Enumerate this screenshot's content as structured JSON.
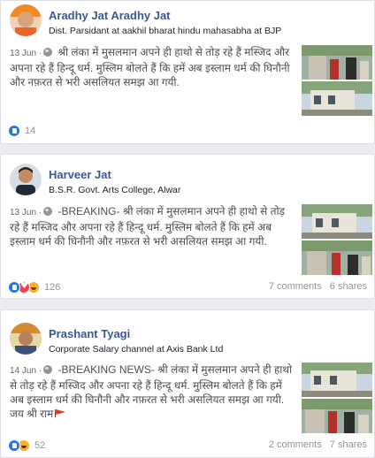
{
  "posts": [
    {
      "author": "Aradhy Jat Aradhy Jat",
      "subtitle": "Dist. Parsidant at aakhil bharat hindu mahasabha at BJP",
      "date": "13 Jun",
      "text": "श्री लंका में मुसलमान अपने ही हाथो से तोड़ रहे हैं मस्जिद और अपना रहे हैं हिन्दू धर्म. मुस्लिम बोलते हैं कि हमें अब इस्लाम धर्म की घिनौनी और नफ़रत से भरी असलियत समझ आ गयी.",
      "reactions": [
        "like"
      ],
      "reaction_count": "14",
      "comments": "",
      "shares": ""
    },
    {
      "author": "Harveer Jat",
      "subtitle": "B.S.R. Govt. Arts College, Alwar",
      "date": "13 Jun",
      "text": "-BREAKING- श्री लंका में मुसलमान अपने ही हाथो से तोड़ रहे हैं मस्जिद और अपना रहे हैं हिन्दू धर्म. मुस्लिम बोलते हैं कि हमें अब इस्लाम धर्म की घिनौनी और नफ़रत से भरी असलियत समझ आ गयी.",
      "reactions": [
        "like",
        "love",
        "haha"
      ],
      "reaction_count": "126",
      "comments": "7 comments",
      "shares": "6 shares"
    },
    {
      "author": "Prashant Tyagi",
      "subtitle": "Corporate Salary channel at Axis Bank Ltd",
      "date": "14 Jun",
      "text": "-BREAKING NEWS- श्री लंका में मुसलमान अपने ही हाथो से तोड़ रहे हैं मस्जिद और अपना रहे हैं हिन्दू धर्म. मुस्लिम बोलते हैं कि हमें अब इस्लाम धर्म की घिनौनी और नफ़रत से भरी असलियत समझ आ गयी. जय श्री राम",
      "reactions": [
        "like",
        "haha"
      ],
      "reaction_count": "52",
      "comments": "2 comments",
      "shares": "7 shares"
    }
  ],
  "icons": {
    "privacy": "globe-icon",
    "flag": "saffron-flag-icon"
  },
  "colors": {
    "author": "#385898",
    "like": "#2078f4",
    "love": "#f33e58",
    "haha": "#f7b125",
    "flag": "#e23b1c"
  }
}
